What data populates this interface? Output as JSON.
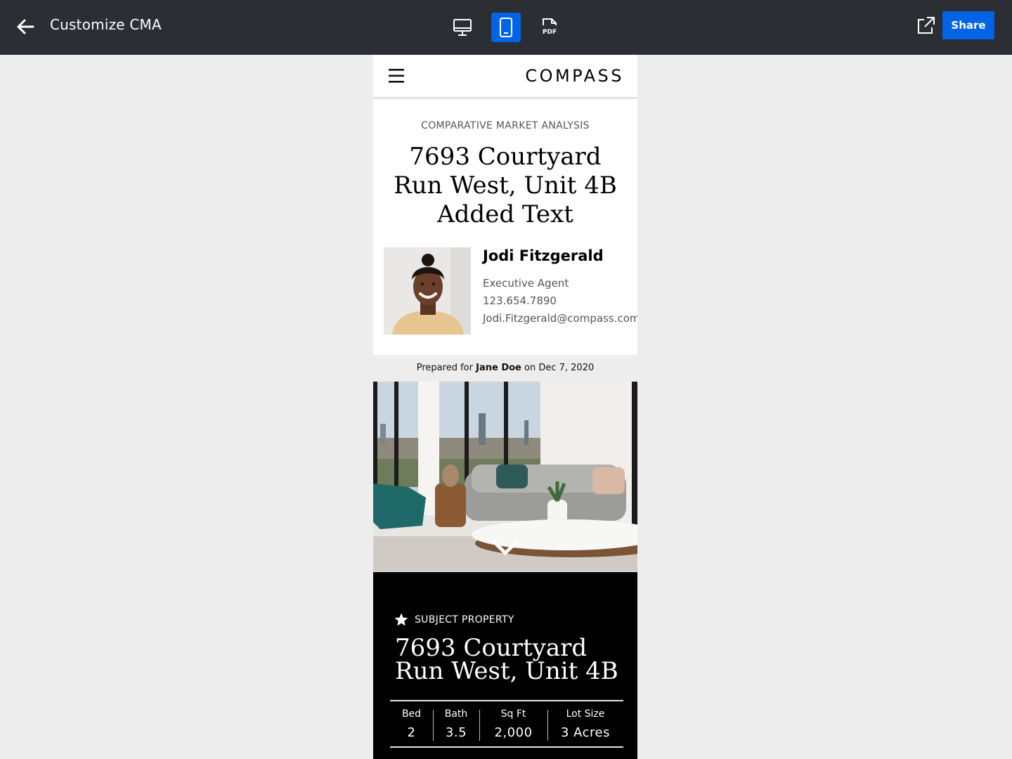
{
  "app": {
    "title": "Customize CMA",
    "share_label": "Share",
    "pdf_label": "PDF",
    "active_view": "mobile"
  },
  "icons": {
    "back": "arrow-left-icon",
    "desktop": "monitor-icon",
    "mobile": "smartphone-icon",
    "pdf": "pdf-file-icon",
    "external": "external-link-icon",
    "menu": "hamburger-icon",
    "star": "star-icon",
    "chevron": "chevron-down-icon"
  },
  "colors": {
    "topbar": "#2b2e33",
    "accent": "#0064e5",
    "subject_bg": "#000000"
  },
  "preview": {
    "logo": "COMPASS",
    "eyebrow": "COMPARATIVE MARKET ANALYSIS",
    "title": "7693 Courtyard Run West, Unit 4B Added Text",
    "agent": {
      "name": "Jodi Fitzgerald",
      "title": "Executive Agent",
      "phone": "123.654.7890",
      "email": "Jodi.Fitzgerald@compass.com"
    },
    "prepared": {
      "prefix": "Prepared for",
      "client": "Jane Doe",
      "date_text": "on Dec 7, 2020"
    },
    "subject": {
      "label": "SUBJECT PROPERTY",
      "title": "7693 Courtyard Run West, Unit 4B",
      "stats": [
        {
          "label": "Bed",
          "value": "2"
        },
        {
          "label": "Bath",
          "value": "3.5"
        },
        {
          "label": "Sq Ft",
          "value": "2,000"
        },
        {
          "label": "Lot Size",
          "value": "3 Acres"
        }
      ]
    }
  }
}
